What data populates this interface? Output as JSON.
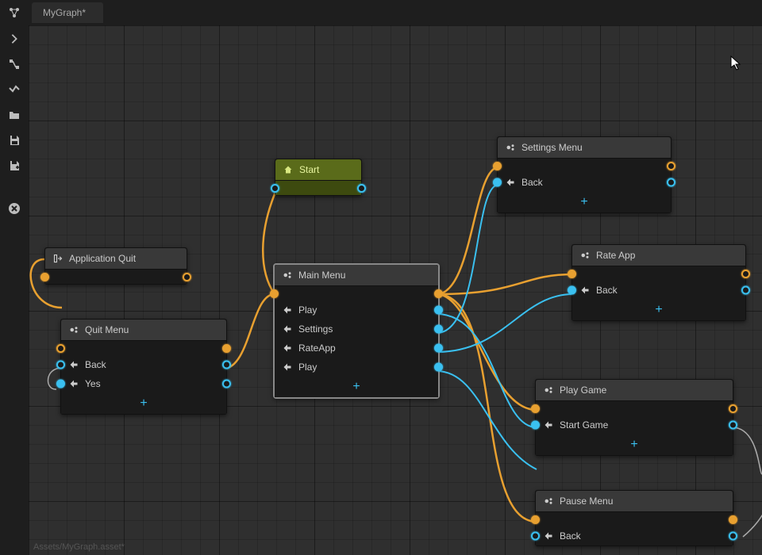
{
  "tab_title": "MyGraph*",
  "status_text": "Assets/MyGraph.asset*",
  "add_label": "+",
  "nodes": {
    "start": {
      "title": "Start"
    },
    "main_menu": {
      "title": "Main Menu",
      "rows": [
        "Play",
        "Settings",
        "RateApp",
        "Play"
      ]
    },
    "app_quit": {
      "title": "Application Quit"
    },
    "quit_menu": {
      "title": "Quit Menu",
      "rows": [
        "Back",
        "Yes"
      ]
    },
    "settings_menu": {
      "title": "Settings Menu",
      "rows": [
        "Back"
      ]
    },
    "rate_app": {
      "title": "Rate App",
      "rows": [
        "Back"
      ]
    },
    "play_game": {
      "title": "Play Game",
      "rows": [
        "Start Game"
      ]
    },
    "pause_menu": {
      "title": "Pause Menu",
      "rows": [
        "Back"
      ]
    }
  }
}
